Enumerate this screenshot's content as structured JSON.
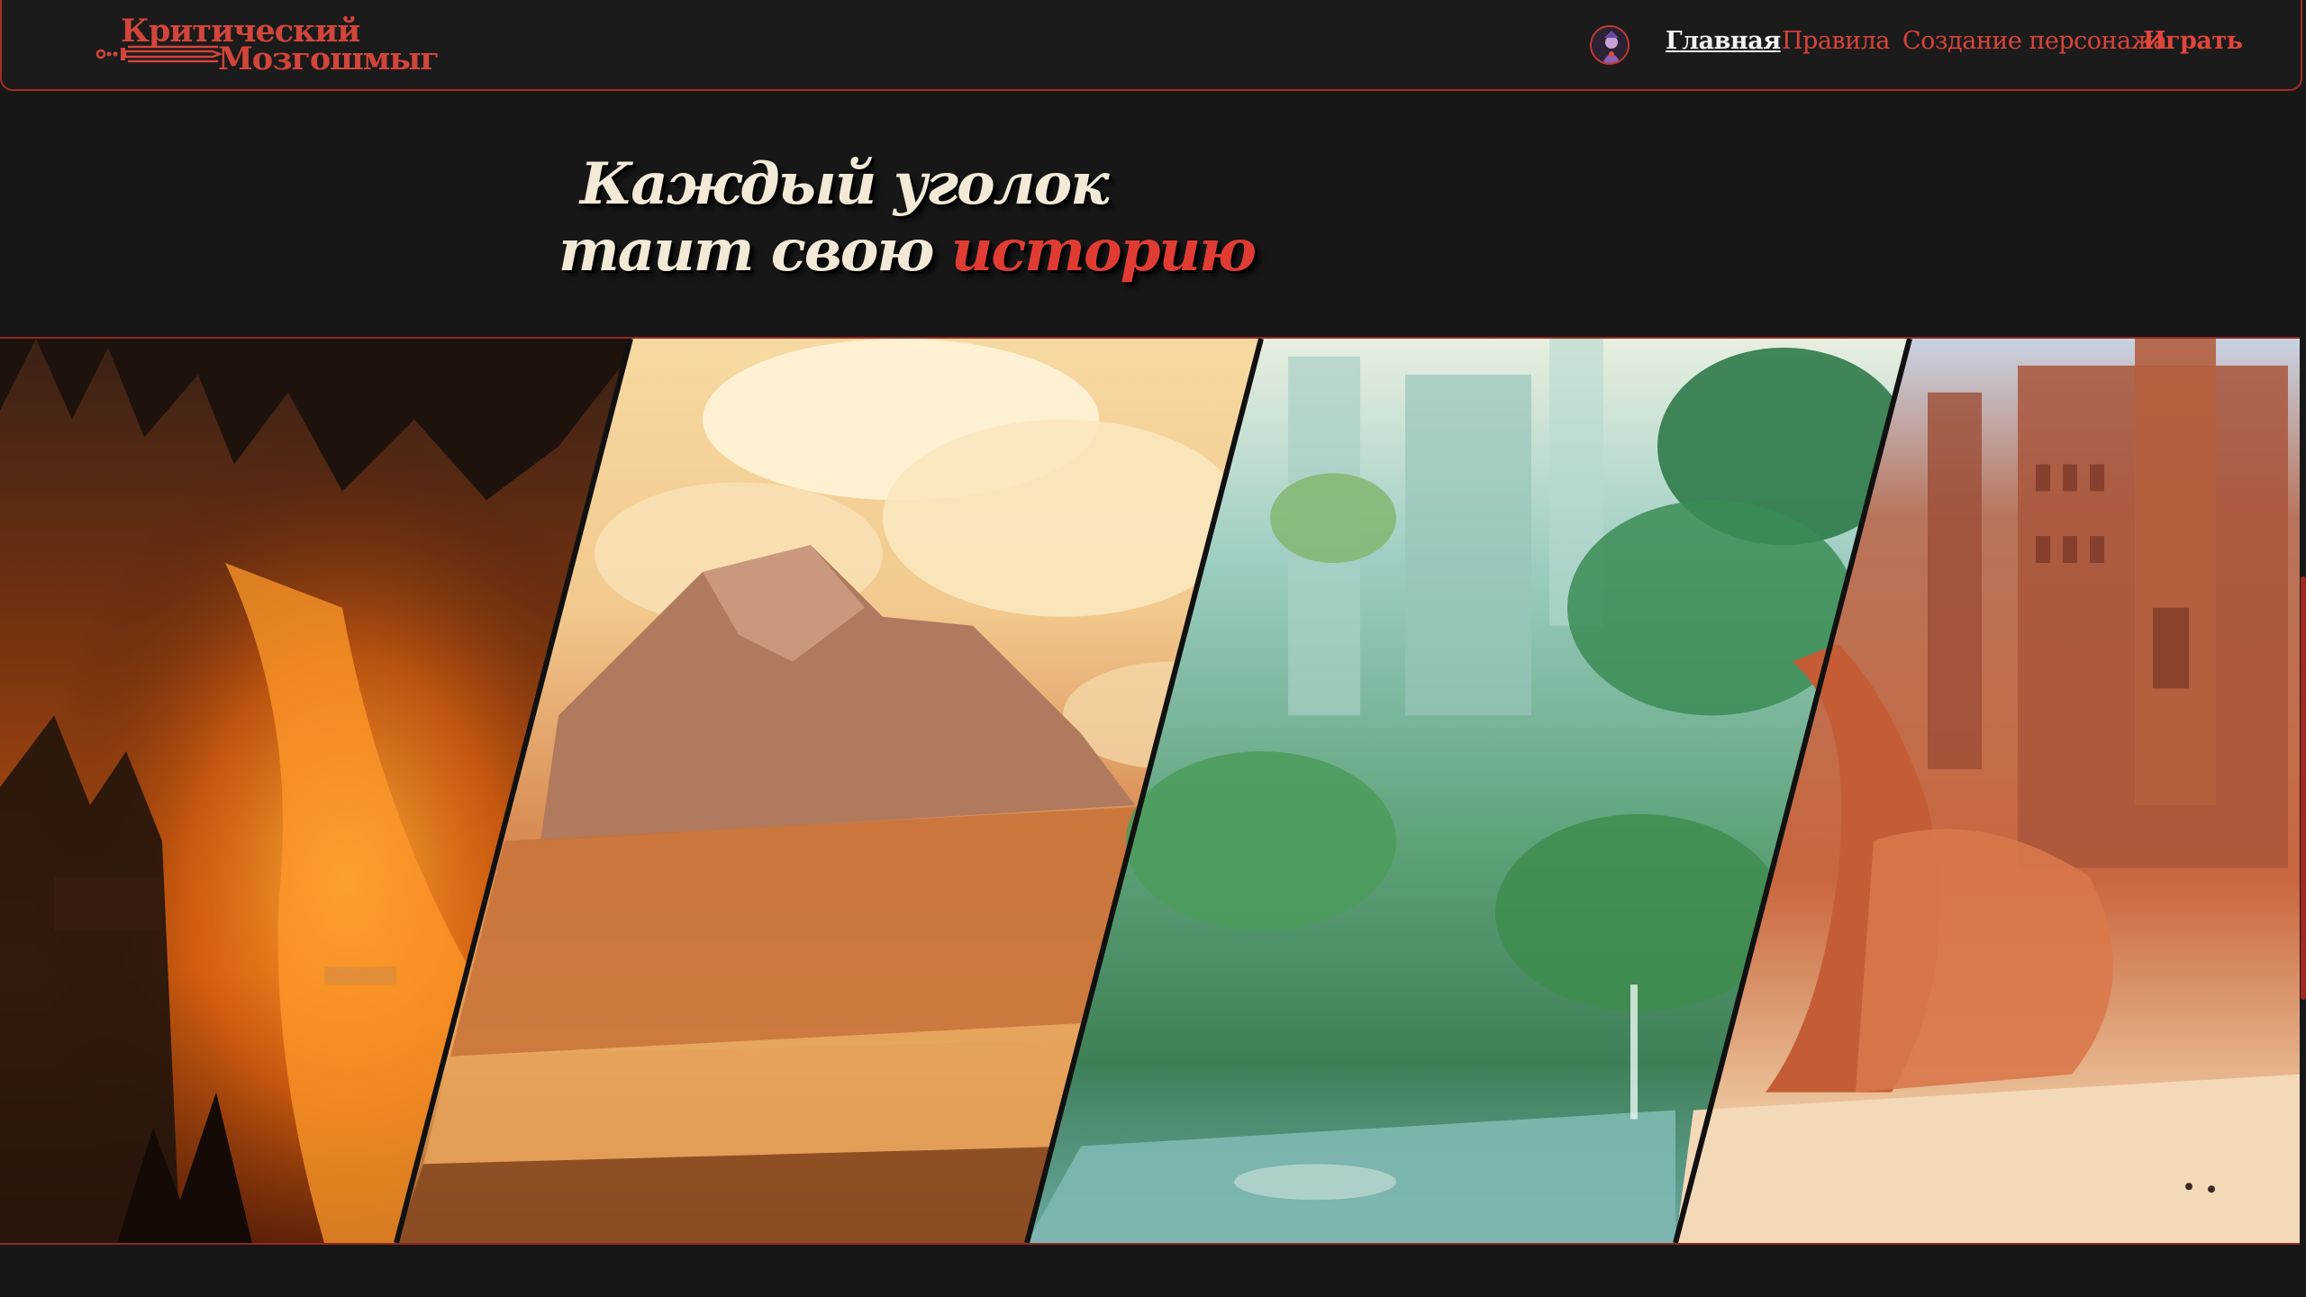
{
  "header": {
    "logo": {
      "line1": "Критический",
      "line2": "Мозгошмыг"
    },
    "nav": {
      "home": "Главная",
      "rules": "Правила",
      "create_character": "Создание персонажа",
      "play": "Играть"
    }
  },
  "hero": {
    "line1": "Каждый уголок",
    "line2_prefix": "таит свою ",
    "line2_accent": "историю"
  },
  "gallery": {
    "panels": [
      "lava-city",
      "mountain-clouds",
      "jungle-ruins",
      "desert-city"
    ]
  },
  "colors": {
    "background": "#171717",
    "accent": "#d9443a",
    "title_text": "#f2ead7"
  },
  "icons": [
    "sword-icon",
    "avatar-icon"
  ]
}
